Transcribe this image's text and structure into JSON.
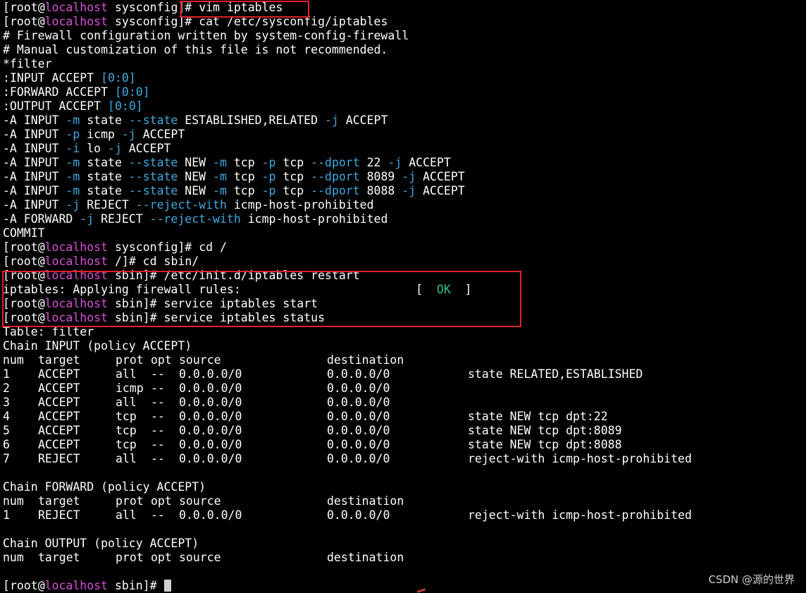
{
  "terminal": {
    "prompt_user": "root",
    "prompt_host": "localhost",
    "lines": {
      "cmd_vim": {
        "dir": "sysconfig",
        "cmd": "vim iptables"
      },
      "cmd_cat": {
        "dir": "sysconfig",
        "cmd": "cat /etc/sysconfig/iptables"
      },
      "cmd_cd_root": {
        "dir": "sysconfig",
        "cmd": "cd /"
      },
      "cmd_cd_sbin": {
        "dir": "/",
        "cmd": "cd sbin/"
      },
      "cmd_restart": {
        "dir": "sbin",
        "cmd": "/etc/init.d/iptables restart"
      },
      "apply_msg": "iptables: Applying firewall rules:",
      "ok_label": "OK",
      "cmd_start": {
        "dir": "sbin",
        "cmd": "service iptables start"
      },
      "cmd_status": {
        "dir": "sbin",
        "cmd": "service iptables status"
      },
      "final_prompt": {
        "dir": "sbin"
      }
    },
    "file_content": {
      "comment1": "# Firewall configuration written by system-config-firewall",
      "comment2": "# Manual customization of this file is not recommended.",
      "filter": "*filter",
      "input_policy": ":INPUT ACCEPT",
      "forward_policy": ":FORWARD ACCEPT",
      "output_policy": ":OUTPUT ACCEPT",
      "counter": "[0:0]",
      "commit": "COMMIT"
    },
    "status": {
      "table": "Table: filter",
      "chain_input": "Chain INPUT (policy ACCEPT)",
      "chain_forward": "Chain FORWARD (policy ACCEPT)",
      "chain_output": "Chain OUTPUT (policy ACCEPT)",
      "headers": [
        "num",
        "target",
        "prot",
        "opt",
        "source",
        "destination"
      ],
      "input_rows": [
        [
          "1",
          "ACCEPT",
          "all",
          "--",
          "0.0.0.0/0",
          "0.0.0.0/0",
          "state RELATED,ESTABLISHED"
        ],
        [
          "2",
          "ACCEPT",
          "icmp",
          "--",
          "0.0.0.0/0",
          "0.0.0.0/0",
          ""
        ],
        [
          "3",
          "ACCEPT",
          "all",
          "--",
          "0.0.0.0/0",
          "0.0.0.0/0",
          ""
        ],
        [
          "4",
          "ACCEPT",
          "tcp",
          "--",
          "0.0.0.0/0",
          "0.0.0.0/0",
          "state NEW tcp dpt:22"
        ],
        [
          "5",
          "ACCEPT",
          "tcp",
          "--",
          "0.0.0.0/0",
          "0.0.0.0/0",
          "state NEW tcp dpt:8089"
        ],
        [
          "6",
          "ACCEPT",
          "tcp",
          "--",
          "0.0.0.0/0",
          "0.0.0.0/0",
          "state NEW tcp dpt:8088"
        ],
        [
          "7",
          "REJECT",
          "all",
          "--",
          "0.0.0.0/0",
          "0.0.0.0/0",
          "reject-with icmp-host-prohibited"
        ]
      ],
      "forward_rows": [
        [
          "1",
          "REJECT",
          "all",
          "--",
          "0.0.0.0/0",
          "0.0.0.0/0",
          "reject-with icmp-host-prohibited"
        ]
      ]
    }
  },
  "watermark": "CSDN @源的世界",
  "colors": {
    "background": "#000000",
    "text": "#ffffff",
    "host": "#d84fd8",
    "option": "#3fa9e0",
    "ok": "#2ec27e",
    "highlight_box": "#e0202a"
  }
}
